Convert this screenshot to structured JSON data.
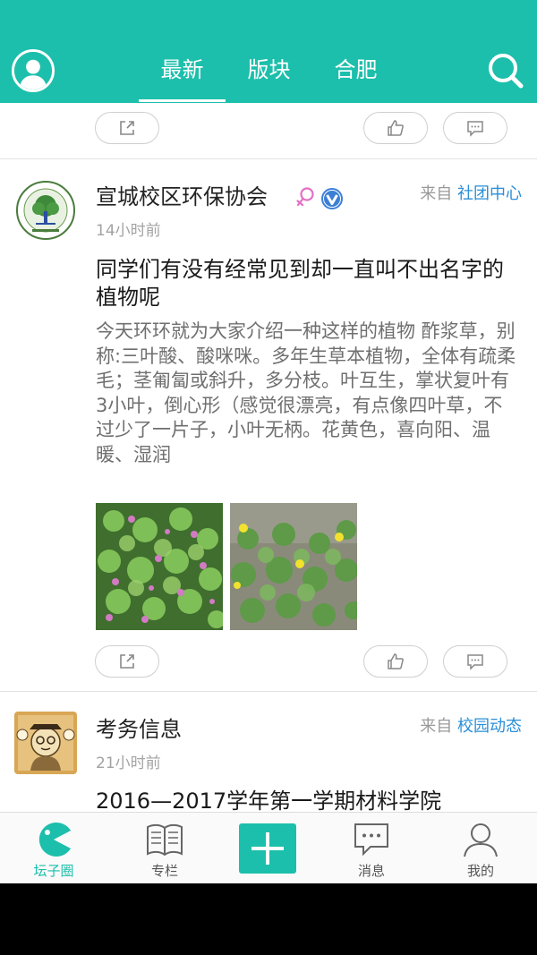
{
  "header": {
    "tabs": [
      "最新",
      "版块",
      "合肥"
    ],
    "active_tab": "最新",
    "accent_color": "#1cbfab"
  },
  "posts": [
    {
      "author": "宣城校区环保协会",
      "time": "14小时前",
      "source_prefix": "来自",
      "source_board": "社团中心",
      "title": "同学们有没有经常见到却一直叫不出名字的植物呢",
      "content": "今天环环就为大家介绍一种这样的植物 酢浆草，别称:三叶酸、酸咪咪。多年生草本植物，全体有疏柔毛；茎匍匐或斜升，多分枝。叶互生，掌状复叶有3小叶，倒心形（感觉很漂亮，有点像四叶草，不过少了一片子，小叶无柄。花黄色，喜向阳、温暖、湿润",
      "images": [
        "pink-wood-sorrel-photo",
        "yellow-wood-sorrel-photo"
      ],
      "badges": [
        "female-icon",
        "verified-icon"
      ]
    },
    {
      "author": "考务信息",
      "time": "21小时前",
      "source_prefix": "来自",
      "source_board": "校园动态",
      "title": "2016—2017学年第一学期材料学院"
    }
  ],
  "bottom_nav": {
    "items": [
      {
        "label": "坛子圈",
        "icon": "pacman-icon",
        "active": true
      },
      {
        "label": "专栏",
        "icon": "book-icon",
        "active": false
      },
      {
        "label": "",
        "icon": "plus-icon",
        "active": false
      },
      {
        "label": "消息",
        "icon": "message-icon",
        "active": false
      },
      {
        "label": "我的",
        "icon": "person-icon",
        "active": false
      }
    ]
  }
}
